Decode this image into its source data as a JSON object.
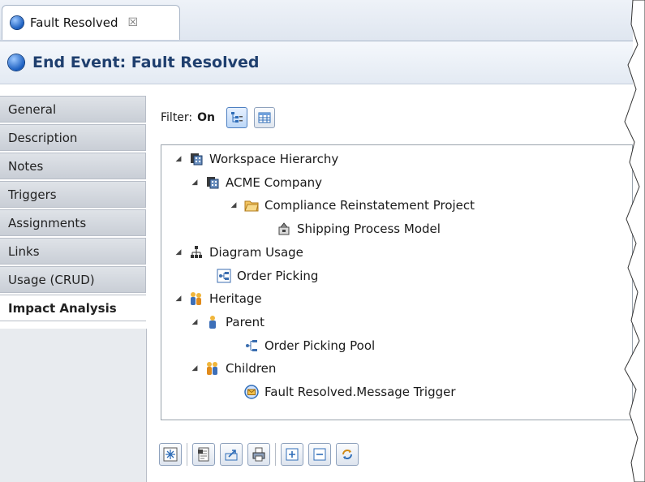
{
  "tab": {
    "label": "Fault Resolved",
    "close": "☒"
  },
  "header": {
    "title": "End Event: Fault Resolved"
  },
  "sidebar": {
    "items": [
      {
        "label": "General"
      },
      {
        "label": "Description"
      },
      {
        "label": "Notes"
      },
      {
        "label": "Triggers"
      },
      {
        "label": "Assignments"
      },
      {
        "label": "Links"
      },
      {
        "label": "Usage (CRUD)"
      },
      {
        "label": "Impact Analysis",
        "active": true
      }
    ]
  },
  "filter": {
    "label": "Filter:",
    "value": "On"
  },
  "tree": {
    "nodes": [
      {
        "label": "Workspace Hierarchy",
        "icon": "workspace-icon",
        "expanded": true
      },
      {
        "label": "ACME Company",
        "icon": "company-icon",
        "expanded": true
      },
      {
        "label": "Compliance Reinstatement Project",
        "icon": "folder-icon",
        "expanded": true
      },
      {
        "label": "Shipping Process Model",
        "icon": "process-model-icon"
      },
      {
        "label": "Diagram Usage",
        "icon": "hierarchy-icon",
        "expanded": true
      },
      {
        "label": "Order Picking",
        "icon": "diagram-icon"
      },
      {
        "label": "Heritage",
        "icon": "people-icon",
        "expanded": true
      },
      {
        "label": "Parent",
        "icon": "person-icon",
        "expanded": true
      },
      {
        "label": "Order Picking Pool",
        "icon": "pool-icon"
      },
      {
        "label": "Children",
        "icon": "people-icon",
        "expanded": true
      },
      {
        "label": "Fault Resolved.Message Trigger",
        "icon": "message-trigger-icon"
      }
    ]
  },
  "colors": {
    "accent": "#1b5fc1",
    "header_text": "#1f3f6e"
  }
}
